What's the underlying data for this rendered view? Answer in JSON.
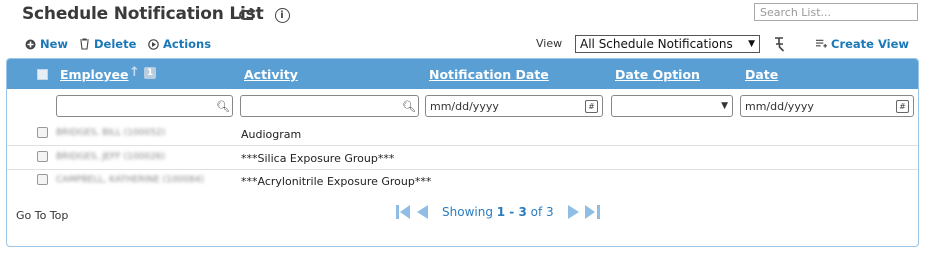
{
  "header": {
    "title": "Schedule Notification List",
    "search_placeholder": "Search List..."
  },
  "toolbar": {
    "new_label": "New",
    "delete_label": "Delete",
    "actions_label": "Actions",
    "view_label": "View",
    "view_selected": "All Schedule Notifications",
    "create_view_label": "Create View"
  },
  "table": {
    "columns": [
      "Employee",
      "Activity",
      "Notification Date",
      "Date Option",
      "Date"
    ],
    "sort_badge": "1",
    "filters": {
      "notification_date_placeholder": "mm/dd/yyyy",
      "date_placeholder": "mm/dd/yyyy"
    },
    "rows": [
      {
        "employee": "BRIDGES, BILL (100052)",
        "activity": "Audiogram"
      },
      {
        "employee": "BRIDGES, JEFF (100026)",
        "activity": "***Silica Exposure Group***"
      },
      {
        "employee": "CAMPBELL, KATHERINE (100084)",
        "activity": "***Acrylonitrile Exposure Group***"
      }
    ]
  },
  "footer": {
    "go_to_top": "Go To Top",
    "showing_prefix": "Showing",
    "range": "1 - 3",
    "of_word": "of",
    "total": "3"
  },
  "colors": {
    "header_bg": "#5a9fd4",
    "link": "#1a78b8",
    "pager": "#2a7cc0"
  }
}
